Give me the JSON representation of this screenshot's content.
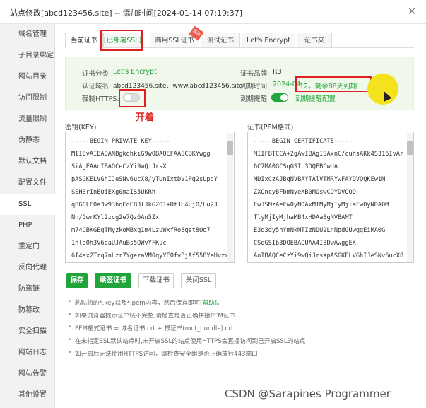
{
  "window": {
    "title": "站点修改[abcd123456.site] -- 添加时间[2024-01-14 07:19:37]",
    "close_icon": "close-icon"
  },
  "sidebar": {
    "items": [
      {
        "label": "域名管理"
      },
      {
        "label": "子目录绑定"
      },
      {
        "label": "网站目录"
      },
      {
        "label": "访问限制"
      },
      {
        "label": "流量限制"
      },
      {
        "label": "伪静态"
      },
      {
        "label": "默认文档"
      },
      {
        "label": "配置文件"
      },
      {
        "label": "SSL",
        "active": true
      },
      {
        "label": "PHP"
      },
      {
        "label": "重定向"
      },
      {
        "label": "反向代理"
      },
      {
        "label": "防盗链"
      },
      {
        "label": "防篡改"
      },
      {
        "label": "安全扫描"
      },
      {
        "label": "网站日志"
      },
      {
        "label": "网站告警"
      },
      {
        "label": "其他设置"
      }
    ]
  },
  "tabs": [
    {
      "label": "当前证书",
      "active": true
    },
    {
      "label": "[已部署SSL]"
    },
    {
      "label": "商用SSL证书"
    },
    {
      "label": "测试证书"
    },
    {
      "label": "Let's Encrypt"
    },
    {
      "label": "证书夹"
    }
  ],
  "badge_hot": "推荐",
  "cert_info": {
    "category_label": "证书分类:",
    "category_value": "Let's Encrypt",
    "brand_label": "证书品牌:",
    "brand_value": "R3",
    "domain_label": "认证域名:",
    "domain_value": "abcd123456.site、www.abcd123456.site",
    "expiry_label": "到期时间:",
    "expiry_value": "2024-04-12。剩余88天到期",
    "expiry_date_part": "2024-04-",
    "expiry_remain_part": "12。剩余88天到期",
    "https_label": "强制HTTPS:",
    "remind_label": "到期提醒:",
    "remind_config": "到期提醒配置"
  },
  "annotation": {
    "open_text": "开着"
  },
  "key_panel": {
    "label": "密钥(KEY)",
    "lines": [
      "-----BEGIN PRIVATE KEY-----",
      "MIIEvAIBADANBgkqhkiG9w0BAQEFAASCBKYwgg",
      "SiAgEAAoIBAQCeCzYi9wQiJrsX",
      "pASGKELVGhIJeSNv6ucX8/yTUnIxtDV1Pg2sUpgY",
      "SSH3rInEQiEXg0maIS5UKRh",
      "qBGCLE0a3w93hqEoEB3lJkGZO1+DtJH4ujO/Uu2J",
      "Nn/GwrKYl2zcg2e7Qz6An5Zx",
      "m74CBKGEgTMyzkoMBxq1m4LzuWxfRo8qst8Oo7",
      "1hla0h3V6qaUJAuBs5OWvYFKuc",
      "6I4ex2Trq7nLzr7YgezaVM0qyYE0fvBjAf558YeHvzx"
    ]
  },
  "cert_panel": {
    "label": "证书(PEM格式)",
    "lines": [
      "-----BEGIN CERTIFICATE-----",
      "MIIFBTCCA+2gAwIBAgISAxnC/cuhsAKk4S316IvAr",
      "6C7MA0GCSqGSIb3DQEBCwUA",
      "MDIxCzAJBgNVBAYTAlVTMRYwFAYDVQQKEw1M",
      "ZXQncyBFbmNyeXB0MQswCQYDVQQD",
      "EwJSMzAeFw0yNDAxMTMyMjIyMjlaFw0yNDA0M",
      "TlyMjIyMjhaMB4xHDAaBgNVBAMT",
      "E3d3dy5hYmNkMTIzNDU2LnNpdGUwggEiMA0G",
      "CSqGSIb3DQEBAQUAA4IBDwAwggEK",
      "AoIBAQCeCzYi9wQiJrsXpASGKELVGhIJeSNv6ucX8"
    ]
  },
  "buttons": {
    "save": "保存",
    "renew": "续签证书",
    "download": "下载证书",
    "close_ssl": "关闭SSL"
  },
  "tips": {
    "tip1_prefix": "粘贴您的*.key以及*.pem内容，然后保存即可",
    "tip1_help": "[帮助]",
    "tip1_suffix": "。",
    "tip2": "如果浏览器提示证书链不完整,请检查是否正确拼接PEM证书",
    "tip3": "PEM格式证书 = 域名证书.crt + 根证书(root_bundle).crt",
    "tip4": "在未指定SSL默认站点时,未开启SSL的站点使用HTTPS会直接访问到已开启SSL的站点",
    "tip5": "如开启后无法使用HTTPS访问，请检查安全组是否正确放行443端口"
  },
  "watermark": "CSDN @Sarapines Programmer",
  "colors": {
    "accent": "#20a53a",
    "annotation_red": "#e02020",
    "highlight_yellow": "#f4e21c"
  }
}
